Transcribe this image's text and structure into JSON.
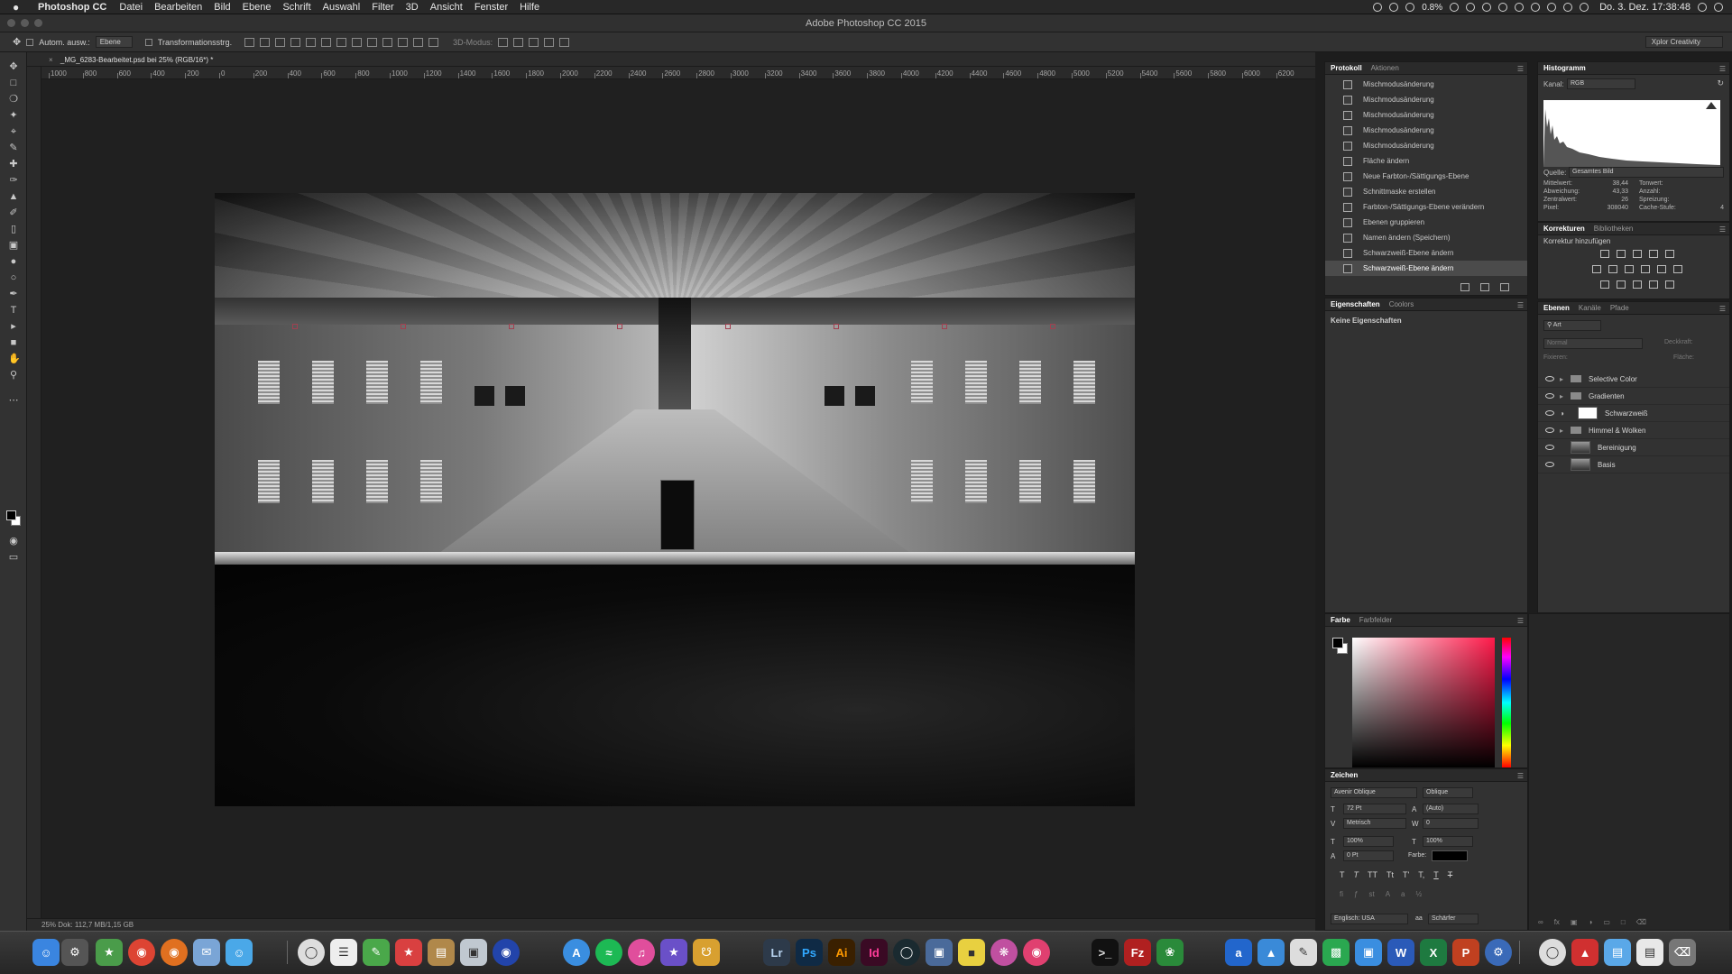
{
  "menubar": {
    "app_name": "Photoshop CC",
    "items": [
      "Datei",
      "Bearbeiten",
      "Bild",
      "Ebene",
      "Schrift",
      "Auswahl",
      "Filter",
      "3D",
      "Ansicht",
      "Fenster",
      "Hilfe"
    ],
    "battery": "0.8%",
    "clock": "Do. 3. Dez.  17:38:48"
  },
  "titlebar": {
    "title": "Adobe Photoshop CC 2015"
  },
  "options": {
    "auto_select_label": "Autom. ausw.:",
    "auto_select_value": "Ebene",
    "transform_label": "Transformationsstrg.",
    "mode_3d_label": "3D-Modus:",
    "workspace": "Xplor Creativity"
  },
  "document": {
    "tab_title": "_MG_6283-Bearbeitet.psd bei 25% (RGB/16*) *",
    "ruler_ticks": [
      "1000",
      "800",
      "600",
      "400",
      "200",
      "0",
      "200",
      "400",
      "600",
      "800",
      "1000",
      "1200",
      "1400",
      "1600",
      "1800",
      "2000",
      "2200",
      "2400",
      "2600",
      "2800",
      "3000",
      "3200",
      "3400",
      "3600",
      "3800",
      "4000",
      "4200",
      "4400",
      "4600",
      "4800",
      "5000",
      "5200",
      "5400",
      "5600",
      "5800",
      "6000",
      "6200"
    ],
    "status": "25%      Dok: 112,7 MB/1,15 GB"
  },
  "history": {
    "tabs": [
      "Protokoll",
      "Aktionen"
    ],
    "items": [
      "Mischmodusänderung",
      "Mischmodusänderung",
      "Mischmodusänderung",
      "Mischmodusänderung",
      "Mischmodusänderung",
      "Fläche ändern",
      "Neue Farbton-/Sättigungs-Ebene",
      "Schnittmaske erstellen",
      "Farbton-/Sättigungs-Ebene verändern",
      "Ebenen gruppieren",
      "Namen ändern (Speichern)",
      "Schwarzweiß-Ebene ändern",
      "Schwarzweiß-Ebene ändern"
    ],
    "selected_index": 12
  },
  "properties": {
    "tabs": [
      "Eigenschaften",
      "Coolors"
    ],
    "empty_text": "Keine Eigenschaften"
  },
  "histogram": {
    "title": "Histogramm",
    "channel_label": "Kanal:",
    "channel_value": "RGB",
    "source_label": "Quelle:",
    "source_value": "Gesamtes Bild",
    "stats_left": [
      {
        "k": "Mittelwert:",
        "v": "38,44"
      },
      {
        "k": "Abweichung:",
        "v": "43,33"
      },
      {
        "k": "Zentralwert:",
        "v": "26"
      },
      {
        "k": "Pixel:",
        "v": "308040"
      }
    ],
    "stats_right": [
      {
        "k": "Tonwert:",
        "v": ""
      },
      {
        "k": "Anzahl:",
        "v": ""
      },
      {
        "k": "Spreizung:",
        "v": ""
      },
      {
        "k": "Cache-Stufe:",
        "v": "4"
      }
    ]
  },
  "adjustments": {
    "tabs": [
      "Korrekturen",
      "Bibliotheken"
    ],
    "add_label": "Korrektur hinzufügen"
  },
  "layers": {
    "tabs": [
      "Ebenen",
      "Kanäle",
      "Pfade"
    ],
    "filter_kind": "Art",
    "blend_mode": "Normal",
    "opacity_label": "Deckkraft:",
    "lock_label": "Fixieren:",
    "fill_label": "Fläche:",
    "rows": [
      {
        "name": "Selective Color",
        "kind": "group"
      },
      {
        "name": "Gradienten",
        "kind": "group"
      },
      {
        "name": "Schwarzweiß",
        "kind": "adjustment"
      },
      {
        "name": "Himmel & Wolken",
        "kind": "group"
      },
      {
        "name": "Bereinigung",
        "kind": "pixel"
      },
      {
        "name": "Basis",
        "kind": "pixel"
      }
    ]
  },
  "color": {
    "tabs": [
      "Farbe",
      "Farbfelder"
    ]
  },
  "character": {
    "title": "Zeichen",
    "font_family": "Avenir Oblique",
    "font_style": "Oblique",
    "font_size": "72 Pt",
    "leading": "(Auto)",
    "kerning": "Metrisch",
    "tracking": "0",
    "vscale": "100%",
    "hscale": "100%",
    "baseline": "0 Pt",
    "color_label": "Farbe:",
    "language": "Englisch: USA",
    "antialias": "Schärfer"
  },
  "dock": {
    "apps": [
      "Lr",
      "Ps",
      "Ai",
      "Id"
    ]
  }
}
